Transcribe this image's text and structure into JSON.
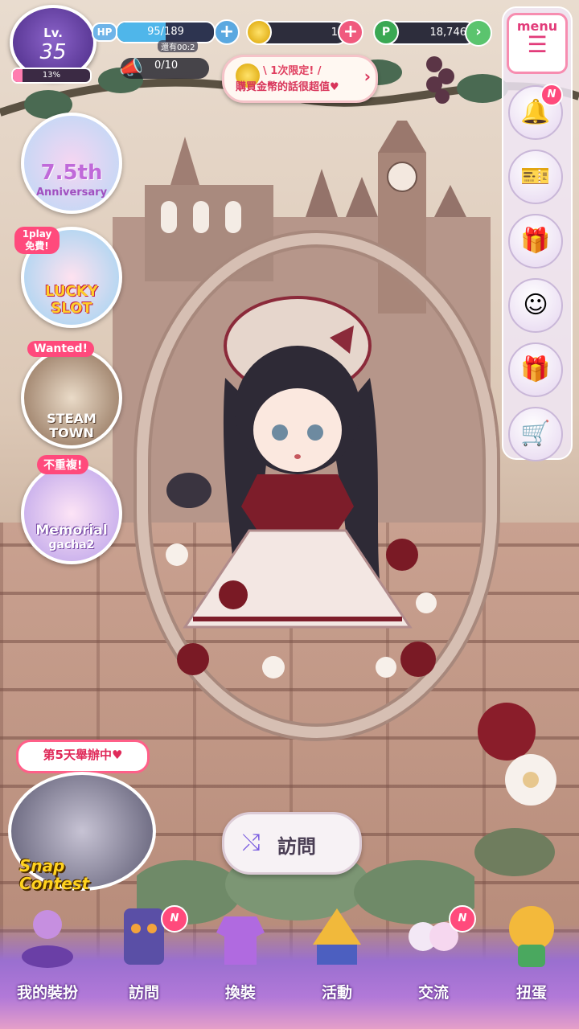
{
  "status": {
    "level_label": "Lv.",
    "level": "35",
    "exp_percent": "13%",
    "exp_fraction": 0.13,
    "hp_tag": "HP",
    "hp_value": "95/189",
    "hp_fraction": 0.5,
    "hp_sub": "還有00:2",
    "coins": "1",
    "points_icon": "P",
    "points": "18,746",
    "tickets": "0/10"
  },
  "promo": {
    "line1": "\\ 1次限定! /",
    "line2": "購買金幣的話很超值♥",
    "arrow": "›"
  },
  "right_menu": {
    "menu_label": "menu",
    "menu_lines": "☰",
    "bell_badge": "N",
    "items": [
      {
        "icon": "bell-icon",
        "glyph": "🔔"
      },
      {
        "icon": "ticket-icon",
        "glyph": "🎫"
      },
      {
        "icon": "gift-icon",
        "glyph": "🎁"
      },
      {
        "icon": "mascot-icon",
        "glyph": "☺"
      },
      {
        "icon": "present-box-icon",
        "glyph": "🎁"
      },
      {
        "icon": "shopping-cart-icon",
        "glyph": "🛒"
      }
    ]
  },
  "events": {
    "anniversary_title": "7.5th",
    "anniversary_sub": "Anniversary",
    "lucky_tag": "1play 免費!",
    "lucky_title": "LUCKY SLOT",
    "wanted_tag": "Wanted!",
    "steam_title": "STEAM TOWN",
    "memorial_tag": "不重複!",
    "memorial_title": "Memorial",
    "memorial_sub": "gacha2"
  },
  "snap": {
    "label": "第5天舉辦中♥",
    "title_line1": "Snap",
    "title_line2": "Contest"
  },
  "visit_button": {
    "icon": "⤭",
    "label": "訪問"
  },
  "nav": {
    "items": [
      {
        "label": "我的裝扮",
        "icon": "dressing-icon",
        "badge": ""
      },
      {
        "label": "訪問",
        "icon": "visit-book-icon",
        "badge": "N"
      },
      {
        "label": "換裝",
        "icon": "wardrobe-icon",
        "badge": ""
      },
      {
        "label": "活動",
        "icon": "tent-icon",
        "badge": ""
      },
      {
        "label": "交流",
        "icon": "friends-icon",
        "badge": "N"
      },
      {
        "label": "扭蛋",
        "icon": "gacha-icon",
        "badge": ""
      }
    ]
  },
  "colors": {
    "accent_pink": "#ff4a7c",
    "menu_pink": "#e23c7a",
    "nav_purple": "#9a6fd0",
    "hp_blue": "#4fb6ea",
    "points_green": "#3aa853"
  }
}
